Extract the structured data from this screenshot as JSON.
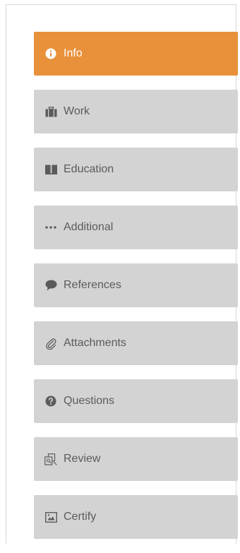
{
  "nav": {
    "items": [
      {
        "label": "Info",
        "icon": "info-circle-icon",
        "active": true
      },
      {
        "label": "Work",
        "icon": "briefcase-icon",
        "active": false
      },
      {
        "label": "Education",
        "icon": "book-icon",
        "active": false
      },
      {
        "label": "Additional",
        "icon": "ellipsis-icon",
        "active": false
      },
      {
        "label": "References",
        "icon": "speech-bubble-icon",
        "active": false
      },
      {
        "label": "Attachments",
        "icon": "paperclip-icon",
        "active": false
      },
      {
        "label": "Questions",
        "icon": "question-circle-icon",
        "active": false
      },
      {
        "label": "Review",
        "icon": "review-pages-icon",
        "active": false
      },
      {
        "label": "Certify",
        "icon": "certificate-icon",
        "active": false
      }
    ]
  },
  "colors": {
    "active_bg": "#e8913a",
    "item_bg": "#d3d3d3",
    "item_text": "#5b5b5b",
    "active_text": "#ffffff"
  }
}
